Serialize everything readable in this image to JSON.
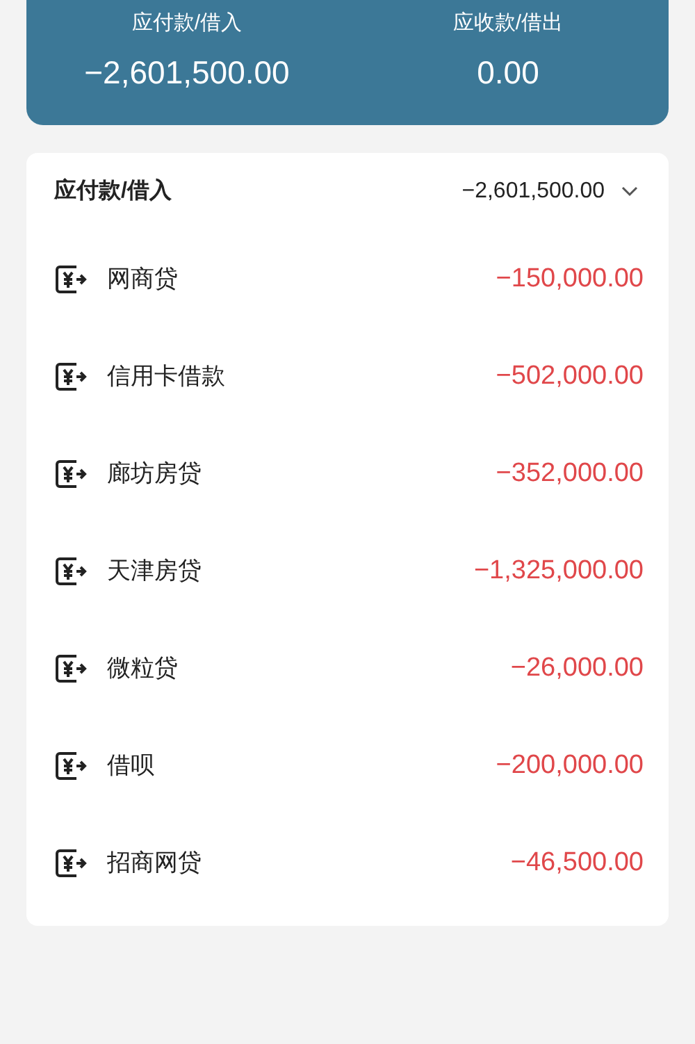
{
  "summary": [
    {
      "label": "应付款/借入",
      "amount": "−2,601,500.00"
    },
    {
      "label": "应收款/借出",
      "amount": "0.00"
    }
  ],
  "section": {
    "title": "应付款/借入",
    "total": "−2,601,500.00",
    "expanded": true
  },
  "items": [
    {
      "name": "网商贷",
      "amount": "−150,000.00"
    },
    {
      "name": "信用卡借款",
      "amount": "−502,000.00"
    },
    {
      "name": "廊坊房贷",
      "amount": "−352,000.00"
    },
    {
      "name": "天津房贷",
      "amount": "−1,325,000.00"
    },
    {
      "name": "微粒贷",
      "amount": "−26,000.00"
    },
    {
      "name": "借呗",
      "amount": "−200,000.00"
    },
    {
      "name": "招商网贷",
      "amount": "−46,500.00"
    }
  ]
}
